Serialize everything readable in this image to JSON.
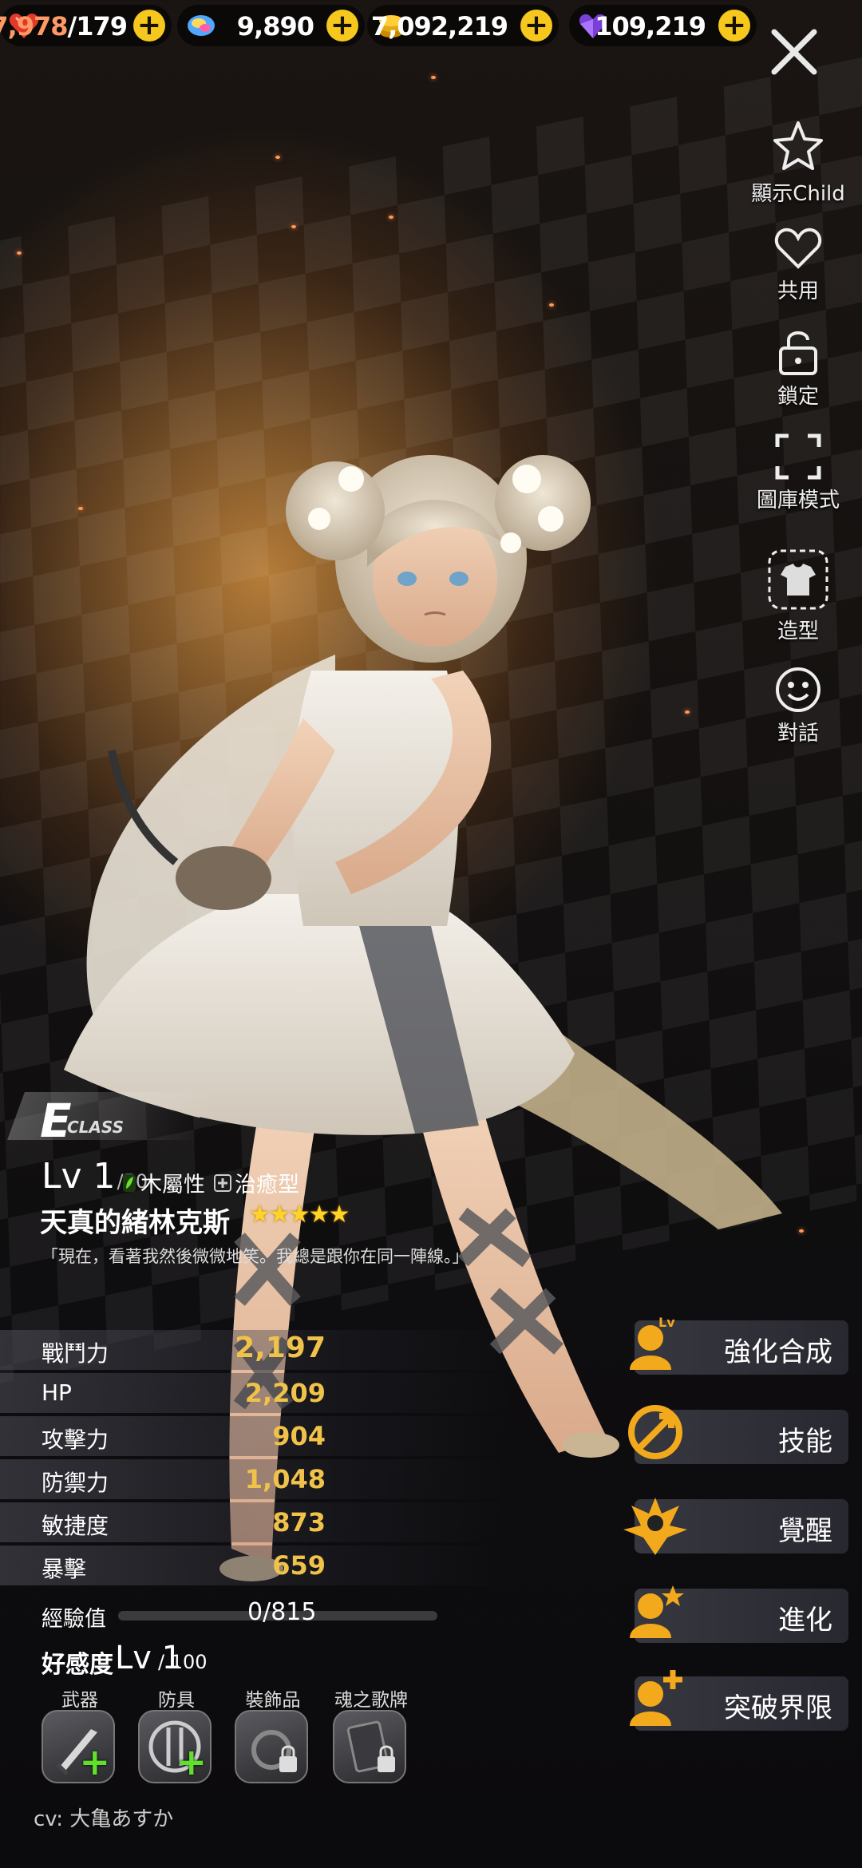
{
  "resources": [
    {
      "name": "stamina",
      "icon": "heart-stamina-icon",
      "value": "7,978",
      "max": "/179"
    },
    {
      "name": "gems",
      "icon": "rainbow-gem-icon",
      "value": "9,890"
    },
    {
      "name": "gold",
      "icon": "gold-coin-icon",
      "value": "7,092,219"
    },
    {
      "name": "soul",
      "icon": "purple-heart-gem-icon",
      "value": "109,219"
    }
  ],
  "side_menu": [
    {
      "icon": "star-icon",
      "label": "顯示Child"
    },
    {
      "icon": "heart-icon",
      "label": "共用"
    },
    {
      "icon": "lock-icon",
      "label": "鎖定"
    },
    {
      "icon": "fullscreen-icon",
      "label": "圖庫模式"
    },
    {
      "icon": "costume-icon",
      "label": "造型"
    },
    {
      "icon": "smile-icon",
      "label": "對話"
    }
  ],
  "character": {
    "class_letter": "E",
    "class_word": "CLASS",
    "level": "Lv 1",
    "level_max": "/50",
    "element": "木屬性",
    "role": "治癒型",
    "name": "天真的緒林克斯",
    "stars": "★★★★★",
    "rarity": 5,
    "quote": "「現在，看著我然後微微地笑。我總是跟你在同一陣線。」"
  },
  "stats": [
    {
      "label": "戰鬥力",
      "value": "2,197"
    },
    {
      "label": "HP",
      "value": "2,209"
    },
    {
      "label": "攻擊力",
      "value": "904"
    },
    {
      "label": "防禦力",
      "value": "1,048"
    },
    {
      "label": "敏捷度",
      "value": "873"
    },
    {
      "label": "暴擊",
      "value": "659"
    }
  ],
  "exp": {
    "label": "經驗值",
    "value": "0/815",
    "fraction": 0
  },
  "affection": {
    "label": "好感度",
    "level": "Lv 1",
    "max": "/ 100"
  },
  "equipment": [
    {
      "label": "武器",
      "icon": "sword-icon",
      "state": "add"
    },
    {
      "label": "防具",
      "icon": "shield-icon",
      "state": "add"
    },
    {
      "label": "裝飾品",
      "icon": "ring-icon",
      "state": "locked"
    },
    {
      "label": "魂之歌牌",
      "icon": "card-icon",
      "state": "locked"
    }
  ],
  "actions": [
    {
      "label": "強化合成",
      "icon": "level-up-icon",
      "badge": "Lv"
    },
    {
      "label": "技能",
      "icon": "skill-icon"
    },
    {
      "label": "覺醒",
      "icon": "awaken-icon"
    },
    {
      "label": "進化",
      "icon": "evolve-icon"
    },
    {
      "label": "突破界限",
      "icon": "limit-break-icon"
    }
  ],
  "cv": "cv: 大亀あすか",
  "colors": {
    "accent_gold": "#f6c81d",
    "stat_value": "#f0c24a",
    "equip_add": "#5fe02a"
  }
}
